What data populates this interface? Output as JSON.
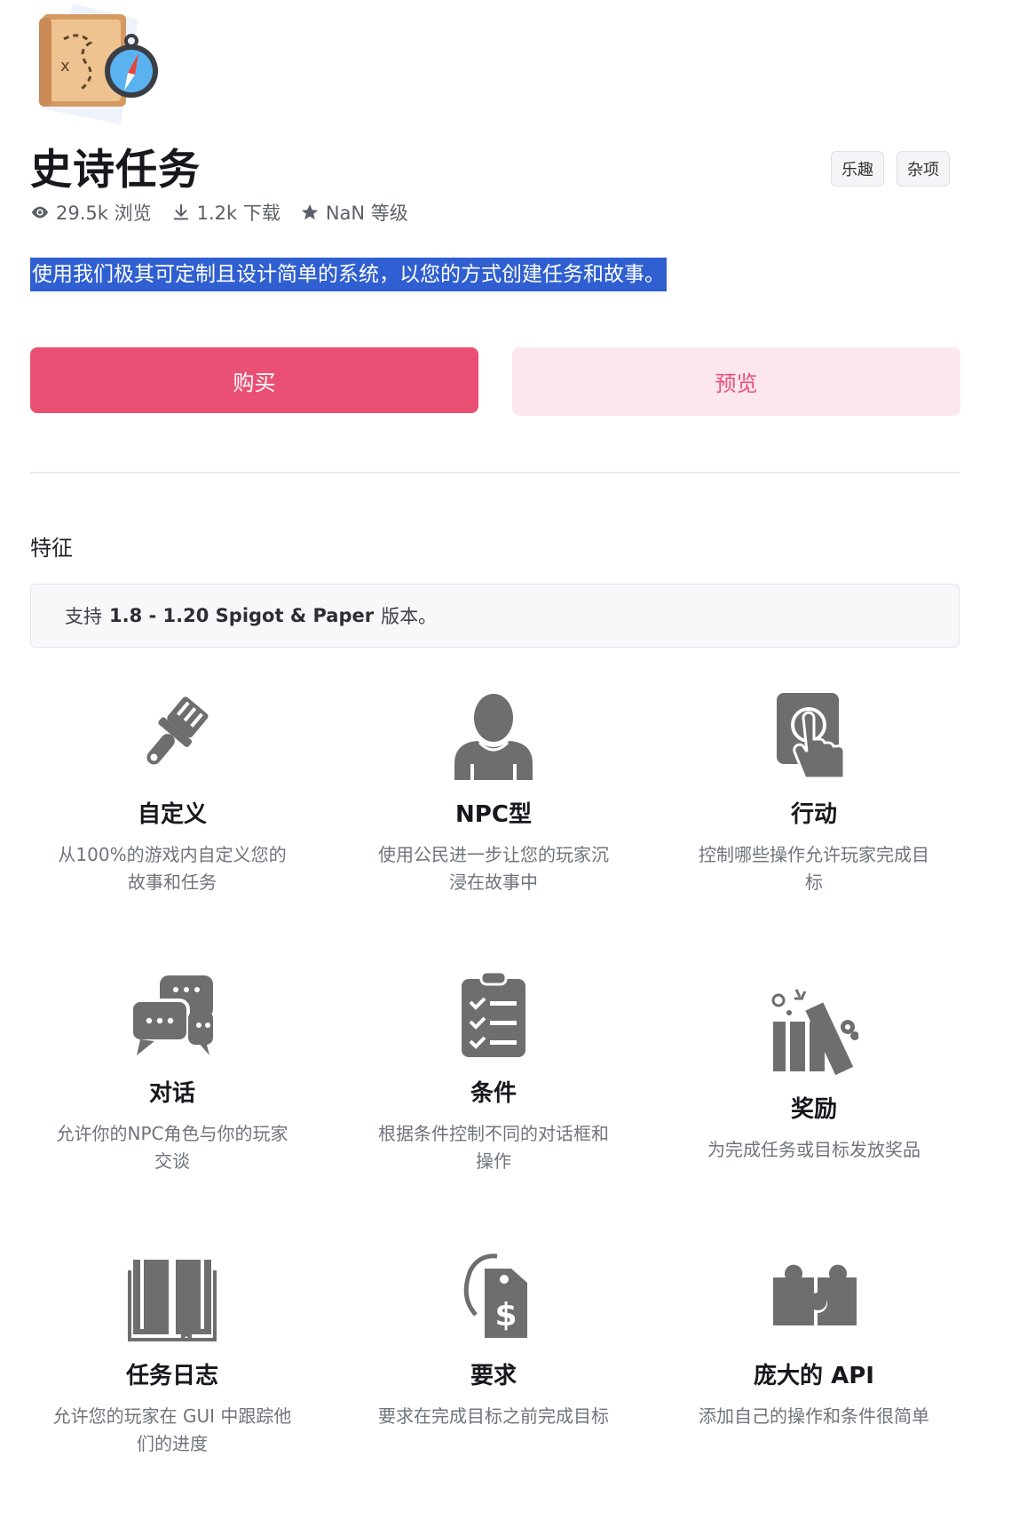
{
  "product": {
    "title": "史诗任务",
    "tags": [
      "乐趣",
      "杂项"
    ],
    "stats": {
      "views": "29.5k 浏览",
      "downloads": "1.2k 下载",
      "rating": "NaN 等级"
    },
    "description": "使用我们极其可定制且设计简单的系统，以您的方式创建任务和故事。"
  },
  "actions": {
    "buy_label": "购买",
    "preview_label": "预览"
  },
  "features": {
    "heading": "特征",
    "notice": {
      "prefix": "支持",
      "versions": "1.8 - 1.20 Spigot & Paper",
      "suffix": "版本。"
    },
    "items": [
      {
        "icon": "paintbrush-icon",
        "title": "自定义",
        "desc": "从100%的游戏内自定义您的故事和任务"
      },
      {
        "icon": "user-icon",
        "title": "NPC型",
        "desc": "使用公民进一步让您的玩家沉浸在故事中"
      },
      {
        "icon": "pointer-icon",
        "title": "行动",
        "desc": "控制哪些操作允许玩家完成目标"
      },
      {
        "icon": "comments-icon",
        "title": "对话",
        "desc": "允许你的NPC角色与你的玩家交谈"
      },
      {
        "icon": "clipboard-list-icon",
        "title": "条件",
        "desc": "根据条件控制不同的对话框和操作"
      },
      {
        "icon": "gift-icon",
        "title": "奖励",
        "desc": "为完成任务或目标发放奖品"
      },
      {
        "icon": "book-icon",
        "title": "任务日志",
        "desc": "允许您的玩家在 GUI 中跟踪他们的进度"
      },
      {
        "icon": "price-tag-icon",
        "title": "要求",
        "desc": "要求在完成目标之前完成目标"
      },
      {
        "icon": "puzzle-icon",
        "title": "庞大的 API",
        "desc": "添加自己的操作和条件很简单"
      }
    ]
  }
}
